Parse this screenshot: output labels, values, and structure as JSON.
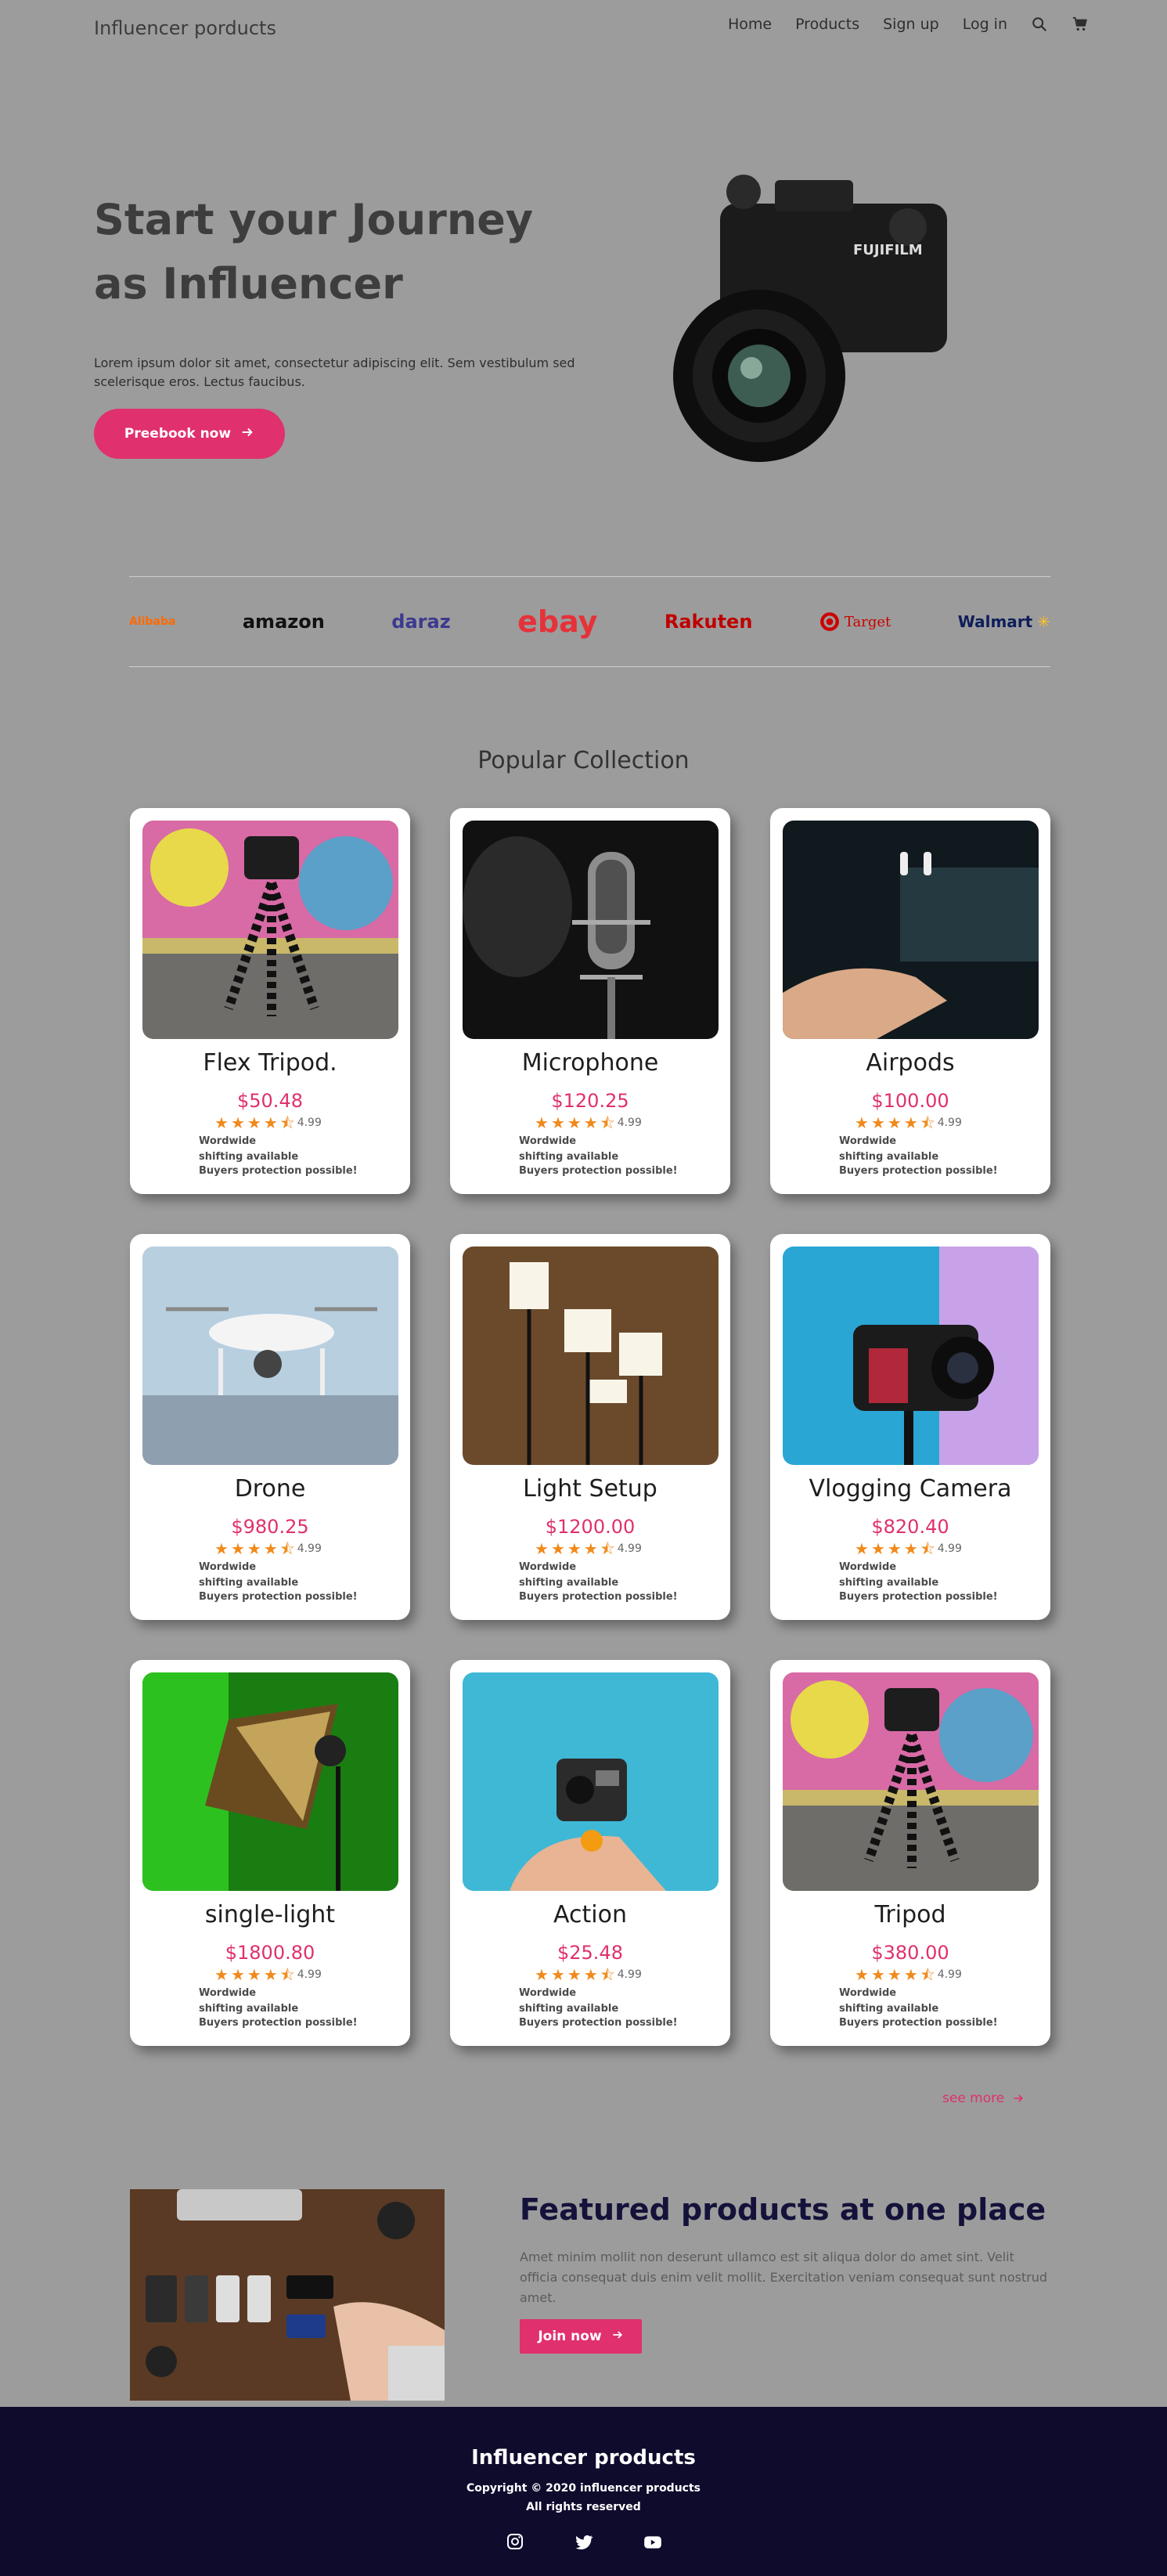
{
  "nav": {
    "brand": "Influencer porducts",
    "links": [
      "Home",
      "Products",
      "Sign up",
      "Log in"
    ]
  },
  "hero": {
    "title": "Start your Journey as Influencer",
    "description": "Lorem ipsum dolor sit amet, consectetur adipiscing elit. Sem vestibulum sed scelerisque eros. Lectus faucibus.",
    "button_label": "Preebook now"
  },
  "brands": [
    "Alibaba",
    "amazon",
    "daraz",
    "ebay",
    "Rakuten",
    "Target",
    "Walmart"
  ],
  "collection": {
    "title": "Popular Collection",
    "products": [
      {
        "name": "Flex Tripod.",
        "price": "$50.48",
        "rating": "4.99",
        "shipping": "Wordwide shifting available",
        "protection": "Buyers protection possible!"
      },
      {
        "name": "Microphone",
        "price": "$120.25",
        "rating": "4.99",
        "shipping": "Wordwide shifting available",
        "protection": "Buyers protection possible!"
      },
      {
        "name": "Airpods",
        "price": "$100.00",
        "rating": "4.99",
        "shipping": "Wordwide shifting available",
        "protection": "Buyers protection possible!"
      },
      {
        "name": "Drone",
        "price": "$980.25",
        "rating": "4.99",
        "shipping": "Wordwide shifting available",
        "protection": "Buyers protection possible!"
      },
      {
        "name": "Light Setup",
        "price": "$1200.00",
        "rating": "4.99",
        "shipping": "Wordwide shifting available",
        "protection": "Buyers protection possible!"
      },
      {
        "name": "Vlogging Camera",
        "price": "$820.40",
        "rating": "4.99",
        "shipping": "Wordwide shifting available",
        "protection": "Buyers protection possible!"
      },
      {
        "name": "single-light",
        "price": "$1800.80",
        "rating": "4.99",
        "shipping": "Wordwide shifting available",
        "protection": "Buyers protection possible!"
      },
      {
        "name": "Action",
        "price": "$25.48",
        "rating": "4.99",
        "shipping": "Wordwide shifting available",
        "protection": "Buyers protection possible!"
      },
      {
        "name": "Tripod",
        "price": "$380.00",
        "rating": "4.99",
        "shipping": "Wordwide shifting available",
        "protection": "Buyers protection possible!"
      }
    ],
    "see_more": "see more"
  },
  "featured": {
    "title": "Featured products at one place",
    "description": "Amet minim mollit non deserunt ullamco est sit aliqua dolor do amet sint. Velit officia consequat duis enim velit mollit. Exercitation veniam consequat sunt nostrud amet.",
    "button_label": "Join now"
  },
  "footer": {
    "brand": "Influencer products",
    "copyright": "Copyright © 2020 influencer products",
    "rights": "All rights reserved"
  },
  "colors": {
    "accent": "#e0306d",
    "background": "#9c9c9c",
    "footer": "#0f0b2d"
  }
}
